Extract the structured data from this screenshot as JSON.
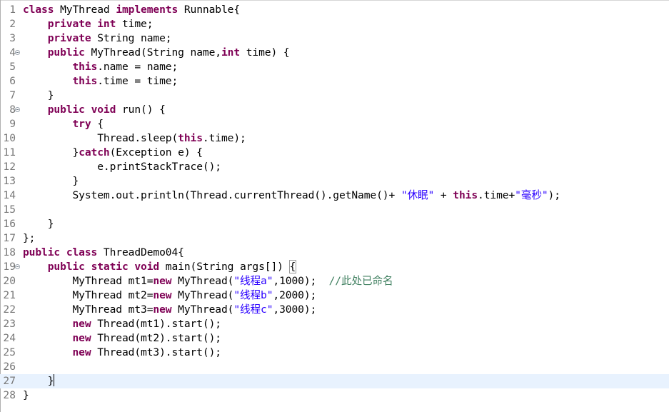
{
  "editor": {
    "language": "java",
    "current_line": 27,
    "colors": {
      "keyword": "#7f0055",
      "string": "#2a00ff",
      "comment": "#3f7f5f",
      "line_number": "#787878",
      "current_line_bg": "#e8f2fe"
    },
    "lines": [
      {
        "n": "1",
        "fold": false,
        "tokens": [
          {
            "t": "class",
            "c": "kw"
          },
          {
            "t": " MyThread "
          },
          {
            "t": "implements",
            "c": "kw"
          },
          {
            "t": " Runnable{"
          }
        ]
      },
      {
        "n": "2",
        "fold": false,
        "tokens": [
          {
            "t": "    "
          },
          {
            "t": "private",
            "c": "kw"
          },
          {
            "t": " "
          },
          {
            "t": "int",
            "c": "kw"
          },
          {
            "t": " time;"
          }
        ]
      },
      {
        "n": "3",
        "fold": false,
        "tokens": [
          {
            "t": "    "
          },
          {
            "t": "private",
            "c": "kw"
          },
          {
            "t": " String name;"
          }
        ]
      },
      {
        "n": "4",
        "fold": true,
        "tokens": [
          {
            "t": "    "
          },
          {
            "t": "public",
            "c": "kw"
          },
          {
            "t": " MyThread(String name,"
          },
          {
            "t": "int",
            "c": "kw"
          },
          {
            "t": " time) {"
          }
        ]
      },
      {
        "n": "5",
        "fold": false,
        "tokens": [
          {
            "t": "        "
          },
          {
            "t": "this",
            "c": "kw"
          },
          {
            "t": ".name = name;"
          }
        ]
      },
      {
        "n": "6",
        "fold": false,
        "tokens": [
          {
            "t": "        "
          },
          {
            "t": "this",
            "c": "kw"
          },
          {
            "t": ".time = time;"
          }
        ]
      },
      {
        "n": "7",
        "fold": false,
        "tokens": [
          {
            "t": "    }"
          }
        ]
      },
      {
        "n": "8",
        "fold": true,
        "tokens": [
          {
            "t": "    "
          },
          {
            "t": "public",
            "c": "kw"
          },
          {
            "t": " "
          },
          {
            "t": "void",
            "c": "kw"
          },
          {
            "t": " run() {"
          }
        ]
      },
      {
        "n": "9",
        "fold": false,
        "tokens": [
          {
            "t": "        "
          },
          {
            "t": "try",
            "c": "kw"
          },
          {
            "t": " {"
          }
        ]
      },
      {
        "n": "10",
        "fold": false,
        "tokens": [
          {
            "t": "            Thread.sleep("
          },
          {
            "t": "this",
            "c": "kw"
          },
          {
            "t": ".time);"
          }
        ]
      },
      {
        "n": "11",
        "fold": false,
        "tokens": [
          {
            "t": "        }"
          },
          {
            "t": "catch",
            "c": "kw"
          },
          {
            "t": "(Exception e) {"
          }
        ]
      },
      {
        "n": "12",
        "fold": false,
        "tokens": [
          {
            "t": "            e.printStackTrace();"
          }
        ]
      },
      {
        "n": "13",
        "fold": false,
        "tokens": [
          {
            "t": "        }"
          }
        ]
      },
      {
        "n": "14",
        "fold": false,
        "tokens": [
          {
            "t": "        System.out.println(Thread.currentThread().getName()+ "
          },
          {
            "t": "\"休眠\"",
            "c": "str"
          },
          {
            "t": " + "
          },
          {
            "t": "this",
            "c": "kw"
          },
          {
            "t": ".time+"
          },
          {
            "t": "\"毫秒\"",
            "c": "str"
          },
          {
            "t": ");"
          }
        ]
      },
      {
        "n": "15",
        "fold": false,
        "tokens": []
      },
      {
        "n": "16",
        "fold": false,
        "tokens": [
          {
            "t": "    }"
          }
        ]
      },
      {
        "n": "17",
        "fold": false,
        "tokens": [
          {
            "t": "};"
          }
        ]
      },
      {
        "n": "18",
        "fold": false,
        "tokens": [
          {
            "t": "public",
            "c": "kw"
          },
          {
            "t": " "
          },
          {
            "t": "class",
            "c": "kw"
          },
          {
            "t": " ThreadDemo04{"
          }
        ]
      },
      {
        "n": "19",
        "fold": true,
        "tokens": [
          {
            "t": "    "
          },
          {
            "t": "public",
            "c": "kw"
          },
          {
            "t": " "
          },
          {
            "t": "static",
            "c": "kw"
          },
          {
            "t": " "
          },
          {
            "t": "void",
            "c": "kw"
          },
          {
            "t": " main(String args[]) "
          },
          {
            "t": "{",
            "c": "bracket"
          }
        ]
      },
      {
        "n": "20",
        "fold": false,
        "tokens": [
          {
            "t": "        MyThread mt1="
          },
          {
            "t": "new",
            "c": "kw"
          },
          {
            "t": " MyThread("
          },
          {
            "t": "\"线程a\"",
            "c": "str"
          },
          {
            "t": ",1000);  "
          },
          {
            "t": "//此处已命名",
            "c": "cmt"
          }
        ]
      },
      {
        "n": "21",
        "fold": false,
        "tokens": [
          {
            "t": "        MyThread mt2="
          },
          {
            "t": "new",
            "c": "kw"
          },
          {
            "t": " MyThread("
          },
          {
            "t": "\"线程b\"",
            "c": "str"
          },
          {
            "t": ",2000);"
          }
        ]
      },
      {
        "n": "22",
        "fold": false,
        "tokens": [
          {
            "t": "        MyThread mt3="
          },
          {
            "t": "new",
            "c": "kw"
          },
          {
            "t": " MyThread("
          },
          {
            "t": "\"线程c\"",
            "c": "str"
          },
          {
            "t": ",3000);"
          }
        ]
      },
      {
        "n": "23",
        "fold": false,
        "tokens": [
          {
            "t": "        "
          },
          {
            "t": "new",
            "c": "kw"
          },
          {
            "t": " Thread(mt1).start();"
          }
        ]
      },
      {
        "n": "24",
        "fold": false,
        "tokens": [
          {
            "t": "        "
          },
          {
            "t": "new",
            "c": "kw"
          },
          {
            "t": " Thread(mt2).start();"
          }
        ]
      },
      {
        "n": "25",
        "fold": false,
        "tokens": [
          {
            "t": "        "
          },
          {
            "t": "new",
            "c": "kw"
          },
          {
            "t": " Thread(mt3).start();"
          }
        ]
      },
      {
        "n": "26",
        "fold": false,
        "tokens": []
      },
      {
        "n": "27",
        "fold": false,
        "caret": true,
        "tokens": [
          {
            "t": "    }"
          }
        ]
      },
      {
        "n": "28",
        "fold": false,
        "tokens": [
          {
            "t": "}"
          }
        ]
      }
    ]
  }
}
